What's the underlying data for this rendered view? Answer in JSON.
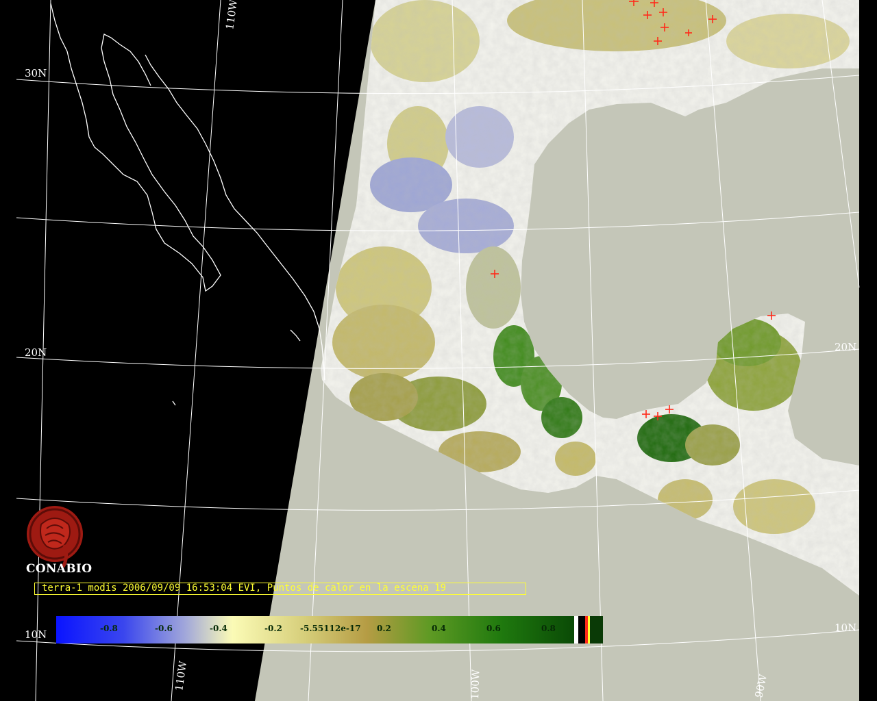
{
  "caption": "terra-1 modis 2006/09/09 16:53:04 EVI, Puntos de calor en la escena 19",
  "logo_text": "CONABIO",
  "grid_labels": {
    "lat_30": "30N",
    "lat_20": "20N",
    "lat_10": "10N",
    "lat_20_east": "20N",
    "lat_10_east": "10N",
    "lon_110_top": "110W",
    "lon_110_bottom": "110W",
    "lon_100": "100W",
    "lon_90": "90W"
  },
  "colorbar": {
    "ticks": [
      "-0.8",
      "-0.6",
      "-0.4",
      "-0.2",
      "-5.55112e-17",
      "0.2",
      "0.4",
      "0.6",
      "0.8"
    ],
    "colors": [
      "#0a14ff",
      "#5a6ae8",
      "#a8aed6",
      "#ffffb0",
      "#d8d070",
      "#b8a040",
      "#5a9a20",
      "#1a7a0a",
      "#0a4a06"
    ]
  },
  "colors": {
    "ocean": "#c4c6b8",
    "no_data": "#000000",
    "coast": "#ffffff",
    "grid": "#ffffff",
    "hotspot": "#ff2a1a",
    "caption": "#ffff33"
  },
  "icons": {
    "logo": "conabio-seal-icon",
    "hotspot": "cross-marker-icon"
  }
}
